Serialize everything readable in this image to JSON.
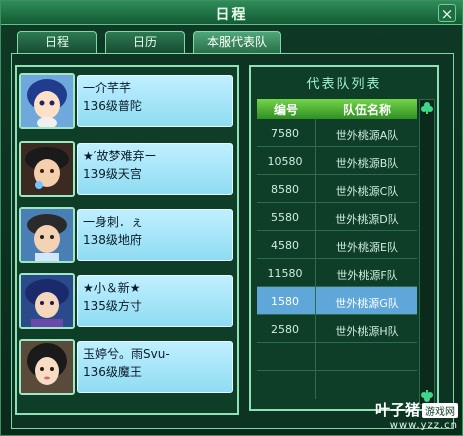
{
  "window": {
    "title": "日程",
    "close_symbol": "×"
  },
  "tabs": [
    {
      "label": "日程"
    },
    {
      "label": "日历"
    },
    {
      "label": "本服代表队"
    }
  ],
  "members": [
    {
      "name": "一介芊芊",
      "level_class": "136级普陀"
    },
    {
      "name": "★′故梦难弃ー",
      "level_class": "139级天宫"
    },
    {
      "name": "一身刺．ぇ",
      "level_class": "138级地府"
    },
    {
      "name": "★小＆新★",
      "level_class": "135级方寸"
    },
    {
      "name": "玉婷兮。雨Svu-",
      "level_class": "136级魔王"
    }
  ],
  "team_list": {
    "title": "代表队列表",
    "headers": {
      "num": "编号",
      "name": "队伍名称"
    },
    "rows": [
      {
        "num": "7580",
        "name": "世外桃源A队"
      },
      {
        "num": "10580",
        "name": "世外桃源B队"
      },
      {
        "num": "8580",
        "name": "世外桃源C队"
      },
      {
        "num": "5580",
        "name": "世外桃源D队"
      },
      {
        "num": "4580",
        "name": "世外桃源E队"
      },
      {
        "num": "11580",
        "name": "世外桃源F队"
      },
      {
        "num": "1580",
        "name": "世外桃源G队"
      },
      {
        "num": "2580",
        "name": "世外桃源H队"
      }
    ],
    "selected_index": 6
  },
  "watermark": {
    "main": "叶子猪",
    "tag": "游戏网",
    "url": "www.yzz.cn"
  },
  "colors": {
    "accent_green": "#74d44a",
    "selected_row": "#5fa7d8",
    "info_box": "#8fdcf2"
  },
  "icons": {
    "scroll_up": "club-up-icon",
    "scroll_down": "club-down-icon"
  }
}
